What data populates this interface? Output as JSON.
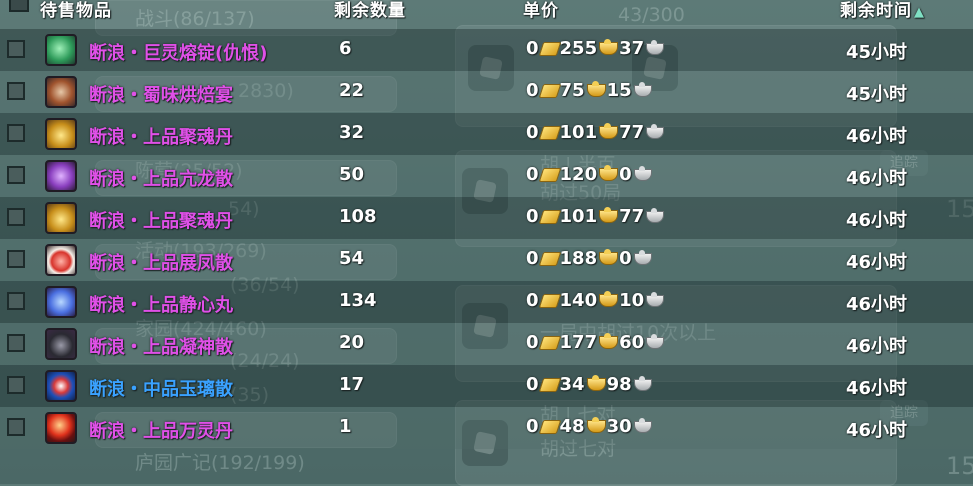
{
  "header": {
    "item_col": "待售物品",
    "qty_col": "剩余数量",
    "price_col": "单价",
    "time_col": "剩余时间",
    "sort_icon": "sort-ascending-icon"
  },
  "background_texts": {
    "t1": "战斗(86/137)",
    "t2": "43/300",
    "t3": "2830)",
    "t4": "陈营(25/52)",
    "t5": "胡 | 半百",
    "t6": "胡过50局",
    "t7": "54)",
    "t8": "活动(193/269)",
    "t9": "(36/54)",
    "t10": "家园(424/460)",
    "t11": "(24/24)",
    "t12": "(35)",
    "t13": "一局中胡过10次以上",
    "t14": "胡 | 七对",
    "t15": "胡过七对",
    "t16": "庐园广记(192/199)",
    "t17": "追踪",
    "t18": "15"
  },
  "colors": {
    "purple": "#e050e8",
    "blue": "#3aa2ff",
    "white": "#ffffff"
  },
  "rows": [
    {
      "name": "断浪・巨灵熔锭(仇恨)",
      "color": "purple",
      "icon": "green-ore-icon",
      "qty": "6",
      "p1": "0",
      "p2": "255",
      "p3": "37",
      "time": "45小时"
    },
    {
      "name": "断浪・蜀味烘焙宴",
      "color": "purple",
      "icon": "feast-platter-icon",
      "qty": "22",
      "p1": "0",
      "p2": "75",
      "p3": "15",
      "time": "45小时"
    },
    {
      "name": "断浪・上品聚魂丹",
      "color": "purple",
      "icon": "golden-pills-icon",
      "qty": "32",
      "p1": "0",
      "p2": "101",
      "p3": "77",
      "time": "46小时"
    },
    {
      "name": "断浪・上品亢龙散",
      "color": "purple",
      "icon": "purple-jar-icon",
      "qty": "50",
      "p1": "0",
      "p2": "120",
      "p3": "0",
      "time": "46小时"
    },
    {
      "name": "断浪・上品聚魂丹",
      "color": "purple",
      "icon": "golden-pills-icon",
      "qty": "108",
      "p1": "0",
      "p2": "101",
      "p3": "77",
      "time": "46小时"
    },
    {
      "name": "断浪・上品展凤散",
      "color": "purple",
      "icon": "red-potion-bottle-icon",
      "qty": "54",
      "p1": "0",
      "p2": "188",
      "p3": "0",
      "time": "46小时"
    },
    {
      "name": "断浪・上品静心丸",
      "color": "purple",
      "icon": "blue-box-icon",
      "qty": "134",
      "p1": "0",
      "p2": "140",
      "p3": "10",
      "time": "46小时"
    },
    {
      "name": "断浪・上品凝神散",
      "color": "purple",
      "icon": "black-powder-icon",
      "qty": "20",
      "p1": "0",
      "p2": "177",
      "p3": "60",
      "time": "46小时"
    },
    {
      "name": "断浪・中品玉璃散",
      "color": "blue",
      "icon": "blue-packet-icon",
      "qty": "17",
      "p1": "0",
      "p2": "34",
      "p3": "98",
      "time": "46小时"
    },
    {
      "name": "断浪・上品万灵丹",
      "color": "purple",
      "icon": "red-pill-icon",
      "qty": "1",
      "p1": "0",
      "p2": "48",
      "p3": "30",
      "time": "46小时"
    }
  ]
}
